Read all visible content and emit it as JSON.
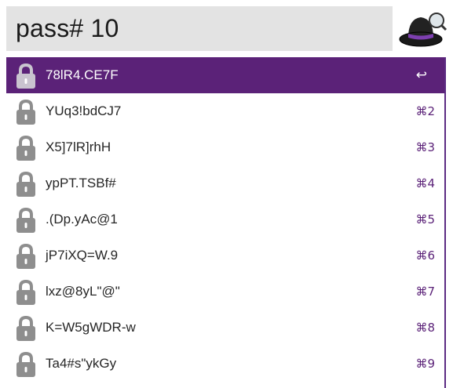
{
  "search": {
    "query": "pass# 10"
  },
  "app_icon": "alfred-hat-icon",
  "colors": {
    "accent": "#5b2278",
    "search_bg": "#e3e3e3",
    "lock_gray": "#8e8e8e"
  },
  "results": [
    {
      "label": "78lR4.CE7F",
      "shortcut": "↩",
      "icon": "lock-icon",
      "selected": true
    },
    {
      "label": "YUq3!bdCJ7",
      "shortcut": "⌘2",
      "icon": "lock-icon"
    },
    {
      "label": "X5]7lR]rhH",
      "shortcut": "⌘3",
      "icon": "lock-icon"
    },
    {
      "label": "ypPT.TSBf#",
      "shortcut": "⌘4",
      "icon": "lock-icon"
    },
    {
      "label": ".(Dp.yAc@1",
      "shortcut": "⌘5",
      "icon": "lock-icon"
    },
    {
      "label": "jP7iXQ=W.9",
      "shortcut": "⌘6",
      "icon": "lock-icon"
    },
    {
      "label": "lxz@8yL\"@\"",
      "shortcut": "⌘7",
      "icon": "lock-icon"
    },
    {
      "label": "K=W5gWDR-w",
      "shortcut": "⌘8",
      "icon": "lock-icon"
    },
    {
      "label": "Ta4#s\"ykGy",
      "shortcut": "⌘9",
      "icon": "lock-icon"
    }
  ]
}
